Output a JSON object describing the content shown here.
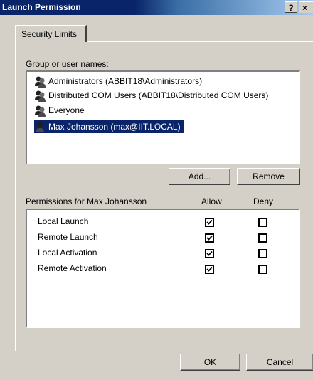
{
  "window": {
    "title": "Launch Permission",
    "help_label": "?",
    "close_label": "×"
  },
  "tabs": [
    {
      "label": "Security Limits",
      "selected": true
    }
  ],
  "groups": {
    "label": "Group or user names:",
    "items": [
      {
        "label": "Administrators (ABBIT18\\Administrators)",
        "icon": "user-group-icon",
        "selected": false
      },
      {
        "label": "Distributed COM Users (ABBIT18\\Distributed COM Users)",
        "icon": "user-group-icon",
        "selected": false
      },
      {
        "label": "Everyone",
        "icon": "user-group-icon",
        "selected": false
      },
      {
        "label": "Max Johansson (max@IIT.LOCAL)",
        "icon": "user-icon",
        "selected": true
      }
    ]
  },
  "buttons": {
    "add": "Add...",
    "remove": "Remove",
    "ok": "OK",
    "cancel": "Cancel"
  },
  "permissions": {
    "label": "Permissions for Max Johansson",
    "allow_header": "Allow",
    "deny_header": "Deny",
    "rows": [
      {
        "name": "Local Launch",
        "allow": true,
        "deny": false
      },
      {
        "name": "Remote Launch",
        "allow": true,
        "deny": false
      },
      {
        "name": "Local Activation",
        "allow": true,
        "deny": false
      },
      {
        "name": "Remote Activation",
        "allow": true,
        "deny": false
      }
    ]
  },
  "colors": {
    "title_bar": "#0a246a",
    "selection": "#0a246a",
    "face": "#d4d0c8"
  }
}
